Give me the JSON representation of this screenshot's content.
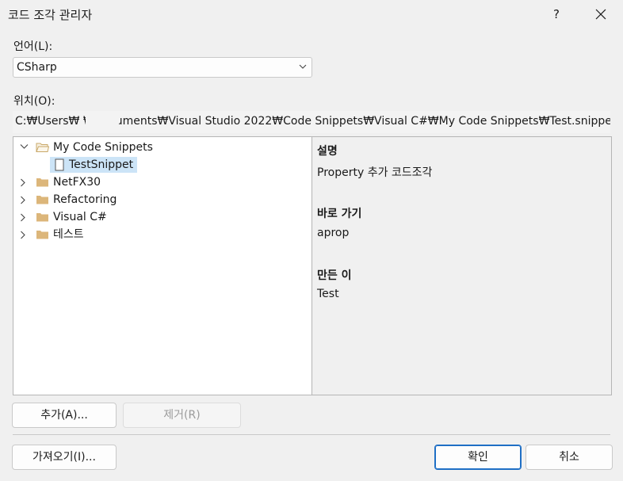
{
  "window": {
    "title": "코드 조각 관리자",
    "help": "?"
  },
  "language": {
    "label": "언어(L):",
    "selected": "CSharp"
  },
  "location": {
    "label": "위치(O):",
    "path": "C:₩Users₩          ₩Documents₩Visual Studio 2022₩Code Snippets₩Visual C#₩My Code Snippets₩Test.snippet"
  },
  "tree": {
    "items": [
      {
        "label": "My Code Snippets"
      },
      {
        "label": "TestSnippet"
      },
      {
        "label": "NetFX30"
      },
      {
        "label": "Refactoring"
      },
      {
        "label": "Visual C#"
      },
      {
        "label": "테스트"
      }
    ]
  },
  "details": {
    "desc_heading": "설명",
    "desc_value": "Property 추가 코드조각",
    "shortcut_heading": "바로 가기",
    "shortcut_value": "aprop",
    "author_heading": "만든 이",
    "author_value": "Test"
  },
  "buttons": {
    "add": "추가(A)...",
    "remove": "제거(R)",
    "import": "가져오기(I)...",
    "ok": "확인",
    "cancel": "취소"
  },
  "colors": {
    "selection": "#cce4f7",
    "folder": "#dcb67a",
    "primary_border": "#1f6fc5"
  }
}
